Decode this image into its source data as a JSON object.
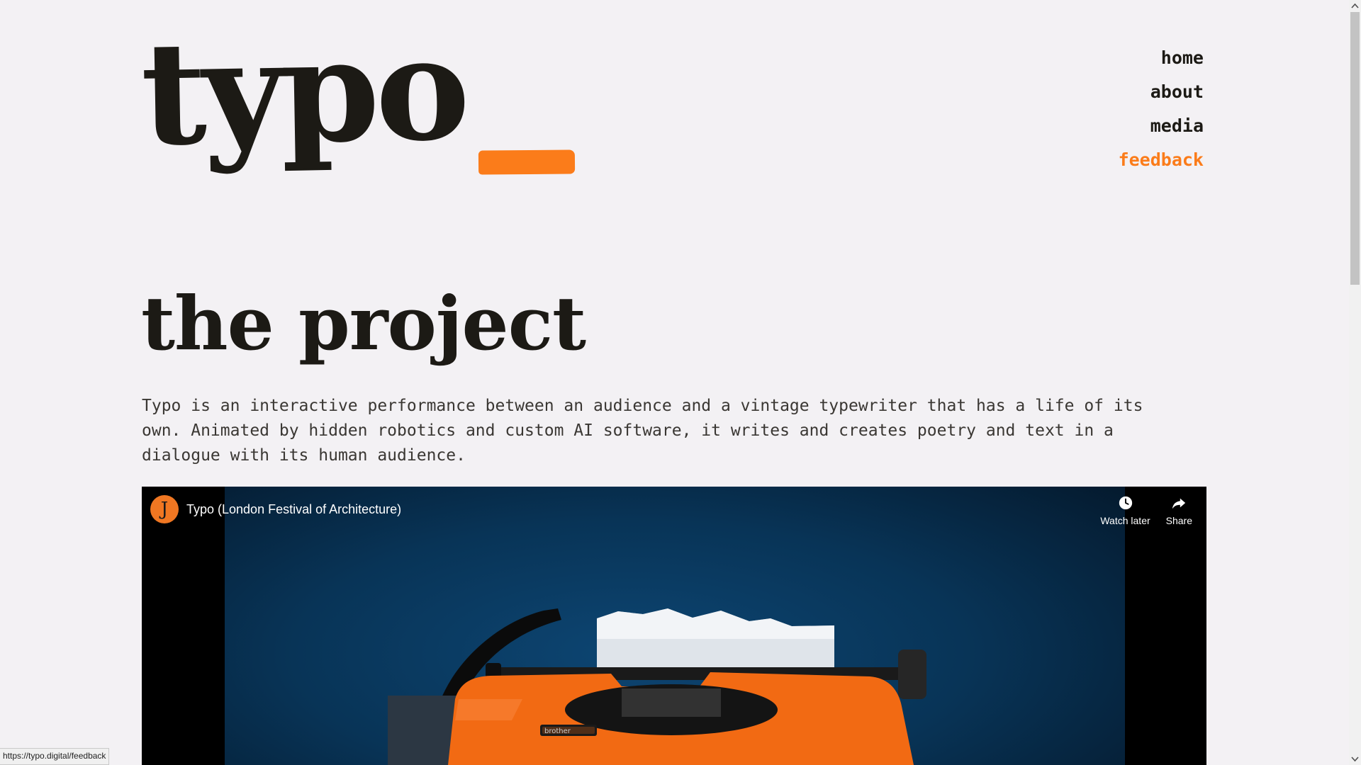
{
  "logo": {
    "text": "typo",
    "accent_color": "#fb7c1a"
  },
  "nav": {
    "items": [
      {
        "label": "home"
      },
      {
        "label": "about"
      },
      {
        "label": "media"
      },
      {
        "label": "feedback"
      }
    ],
    "active": "feedback"
  },
  "section": {
    "title": "the project",
    "intro": "Typo is an interactive performance between an audience and a vintage typewriter that has a life of its own. Animated by hidden robotics and custom AI software, it writes and creates poetry and text in a dialogue with its human audience."
  },
  "video": {
    "channel_initial": "J",
    "title": "Typo (London Festival of Architecture)",
    "actions": {
      "watch_later": "Watch later",
      "share": "Share"
    },
    "typewriter_brand": "brother"
  },
  "status_bar": {
    "url": "https://typo.digital/feedback"
  },
  "colors": {
    "background": "#f3f1f4",
    "ink": "#1c1a15",
    "accent": "#fb7c1a"
  }
}
